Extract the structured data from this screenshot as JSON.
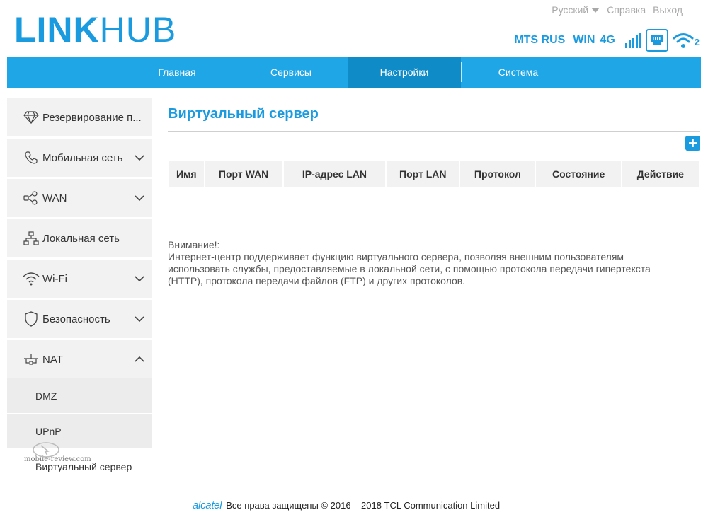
{
  "logo": {
    "bold": "LINK",
    "light": "HUB"
  },
  "top_links": {
    "language": "Русский",
    "help": "Справка",
    "logout": "Выход"
  },
  "status": {
    "operator": "MTS RUS",
    "network_name": "WIN",
    "network_type": "4G",
    "wifi_clients": "2"
  },
  "nav": {
    "items": [
      {
        "label": "Главная"
      },
      {
        "label": "Сервисы"
      },
      {
        "label": "Настройки"
      },
      {
        "label": "Система"
      }
    ],
    "active_index": 2
  },
  "sidebar": {
    "items": [
      {
        "label": "Резервирование п...",
        "icon": "diamond-icon"
      },
      {
        "label": "Мобильная сеть",
        "icon": "phone-icon"
      },
      {
        "label": "WAN",
        "icon": "share-nodes-icon"
      },
      {
        "label": "Локальная сеть",
        "icon": "lan-icon"
      },
      {
        "label": "Wi-Fi",
        "icon": "wifi-icon"
      },
      {
        "label": "Безопасность",
        "icon": "shield-icon"
      },
      {
        "label": "NAT",
        "icon": "nat-icon"
      }
    ],
    "nat_sub": [
      {
        "label": "DMZ"
      },
      {
        "label": "UPnP"
      },
      {
        "label": "Виртуальный сервер"
      }
    ]
  },
  "main": {
    "title": "Виртуальный сервер",
    "table": {
      "columns": [
        "Имя",
        "Порт WAN",
        "IP-адрес LAN",
        "Порт LAN",
        "Протокол",
        "Состояние",
        "Действие"
      ]
    },
    "note_title": "Внимание!:",
    "note_text": "Интернет-центр поддерживает функцию виртуального сервера, позволяя внешним пользователям использовать службы, предоставляемые в локальной сети, с помощью протокола передачи гипертекста (HTTP), протокола передачи файлов (FTP) и других протоколов."
  },
  "watermark": "mobile-review.com",
  "footer": {
    "brand": "alcatel",
    "copyright": "Все права защищены © 2016 – 2018 TCL Communication Limited"
  },
  "colors": {
    "accent": "#1a9be0",
    "nav_bg": "#1ea6e6",
    "nav_active": "#0f8cc8"
  }
}
